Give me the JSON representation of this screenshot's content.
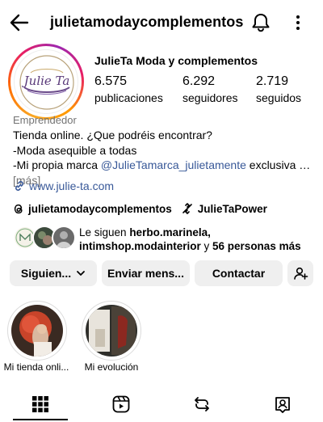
{
  "header": {
    "username": "julietamodaycomplementos"
  },
  "profile": {
    "full_name": "JulieTa Moda y complementos",
    "avatar_logo_text": "Julie Ta",
    "stats": [
      {
        "value": "6.575",
        "label": "publicaciones"
      },
      {
        "value": "6.292",
        "label": "seguidores"
      },
      {
        "value": "2.719",
        "label": "seguidos"
      }
    ],
    "category": "Emprendedor",
    "bio": {
      "line1": "Tienda online. ¿Que podréis encontrar?",
      "line2": "-Moda asequible a todas",
      "line3_prefix": "-Mi propia marca ",
      "line3_mention": "@JulieTamarca_julietamente",
      "line3_suffix": " exclusiva …",
      "more": "[más]"
    },
    "website": "www.julie-ta.com",
    "threads_handle": "julietamodaycomplementos",
    "linked_account": "JulieTaPower"
  },
  "followed_by": {
    "prefix": "Le siguen ",
    "names": "herbo.marinela, intimshop.modainterior",
    "joiner": " y ",
    "others": "56 personas más"
  },
  "actions": {
    "following_label": "Siguien...",
    "message_label": "Enviar mens...",
    "contact_label": "Contactar"
  },
  "highlights": [
    {
      "label": "Mi tienda onli..."
    },
    {
      "label": "Mi evolución"
    }
  ],
  "colors": {
    "link": "#385898",
    "button_bg": "#efefef",
    "muted_text": "#737373"
  }
}
